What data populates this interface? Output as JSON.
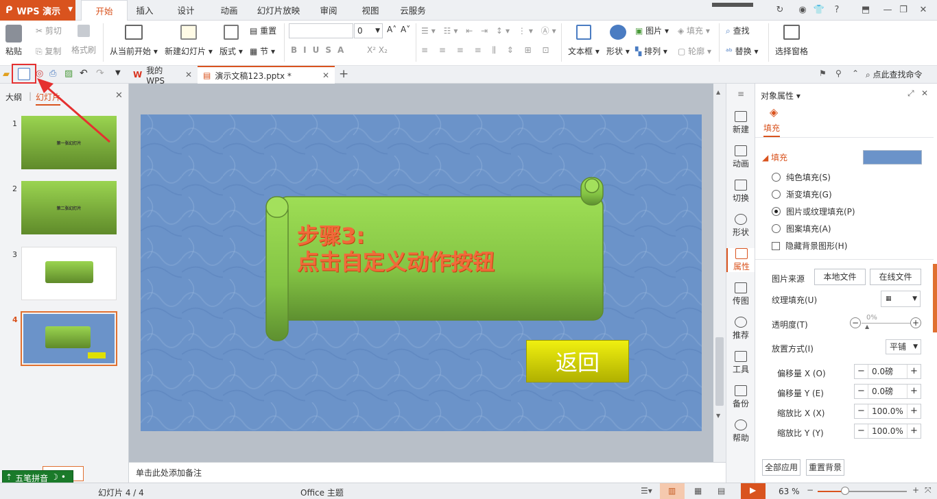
{
  "app": {
    "name": "WPS 演示"
  },
  "menu_tabs": [
    "开始",
    "插入",
    "设计",
    "动画",
    "幻灯片放映",
    "审阅",
    "视图",
    "云服务"
  ],
  "ribbon": {
    "paste": "粘贴",
    "cut": "剪切",
    "copy": "复制",
    "format_painter": "格式刷",
    "from_current": "从当前开始",
    "new_slide": "新建幻灯片",
    "layout": "版式",
    "reset": "重置",
    "section": "节",
    "font_size": "0",
    "textbox": "文本框",
    "shape": "形状",
    "picture": "图片",
    "fill": "填充",
    "arrange": "排列",
    "outline": "轮廓",
    "find": "查找",
    "replace": "替换",
    "selection_pane": "选择窗格"
  },
  "tabs": {
    "wps": "我的WPS",
    "doc": "演示文稿123.pptx *",
    "search": "点此查找命令"
  },
  "left_panel": {
    "outline_tab": "大纲",
    "slides_tab": "幻灯片",
    "numbers": [
      "1",
      "2",
      "3",
      "4"
    ],
    "thumb1": "第一张幻灯片",
    "thumb2": "第二张幻灯片"
  },
  "slide": {
    "line1": "步骤3:",
    "line2": "点击自定义动作按钮",
    "back_button": "返回"
  },
  "notes_placeholder": "单击此处添加备注",
  "sidebar": [
    "新建",
    "动画",
    "切换",
    "形状",
    "属性",
    "传图",
    "推荐",
    "工具",
    "备份",
    "帮助"
  ],
  "props": {
    "title": "对象属性",
    "fill_tab": "填充",
    "fill_section": "填充",
    "options": [
      "纯色填充(S)",
      "渐变填充(G)",
      "图片或纹理填充(P)",
      "图案填充(A)"
    ],
    "selected_option": 2,
    "hide_bg": "隐藏背景图形(H)",
    "pic_source": "图片来源",
    "local_file": "本地文件",
    "online_file": "在线文件",
    "texture_fill": "纹理填充(U)",
    "transparency": "透明度(T)",
    "transparency_val": "0%",
    "placement": "放置方式(I)",
    "placement_val": "平铺",
    "offset_x": "偏移量 X (O)",
    "offset_x_val": "0.0磅",
    "offset_y": "偏移量 Y (E)",
    "offset_y_val": "0.0磅",
    "scale_x": "缩放比 X (X)",
    "scale_x_val": "100.0%",
    "scale_y": "缩放比 Y (Y)",
    "scale_y_val": "100.0%",
    "apply_all": "全部应用",
    "reset_bg": "重置背景"
  },
  "ime": {
    "name": "五笔拼音",
    "mode": "简"
  },
  "status": {
    "slide_info": "幻灯片 4 / 4",
    "theme": "Office 主题",
    "zoom": "63 %"
  },
  "colors": {
    "accent": "#d9531e",
    "slide_bg": "#6b93c9",
    "scroll_green": "#8fcf4f",
    "button_yellow": "#e0e000"
  }
}
